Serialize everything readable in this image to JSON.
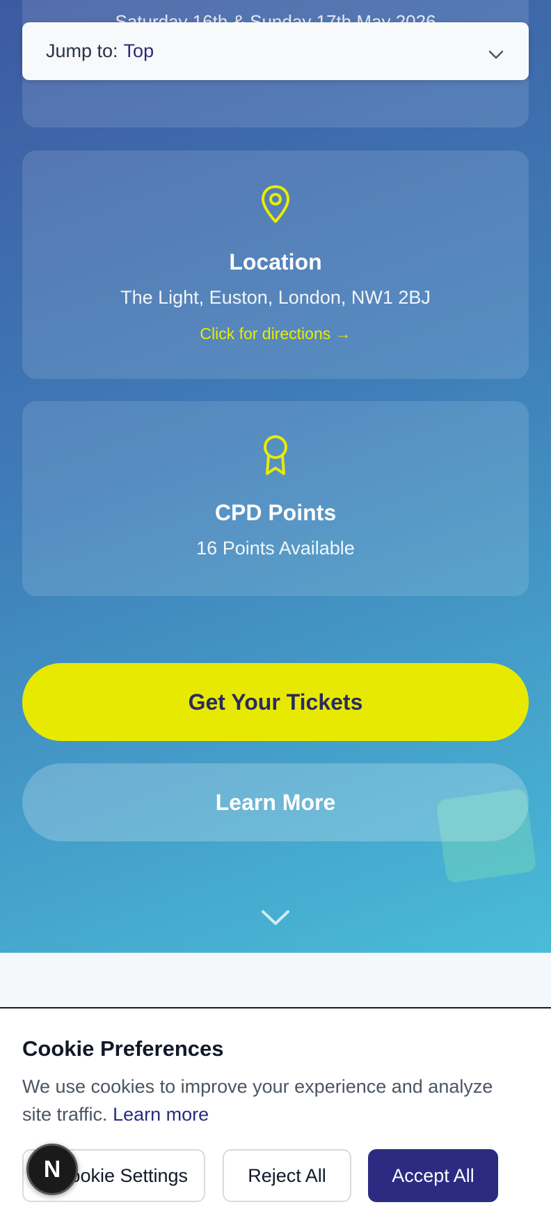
{
  "event_card": {
    "date_text": "Saturday 16th & Sunday 17th May 2026"
  },
  "jump_to": {
    "label": "Jump to:",
    "value": "Top"
  },
  "location": {
    "icon": "map-pin-icon",
    "title": "Location",
    "address": "The Light, Euston, London, NW1 2BJ",
    "link": "Click for directions →"
  },
  "cpd": {
    "icon": "award-ribbon-icon",
    "title": "CPD Points",
    "text": "16 Points Available"
  },
  "cta": {
    "tickets": "Get Your Tickets",
    "learn_more": "Learn More"
  },
  "cookie": {
    "title": "Cookie Preferences",
    "text": "We use cookies to improve your experience and analyze site traffic.",
    "learn_more": "Learn more",
    "settings": "Cookie Settings",
    "reject": "Reject All",
    "accept": "Accept All"
  },
  "dev_badge": {
    "letter": "N"
  },
  "colors": {
    "accent_yellow": "#e7ea00",
    "brand_navy": "#2b2b82",
    "hero_gradient_start": "#3d5aa0",
    "hero_gradient_end": "#49bcd8"
  }
}
